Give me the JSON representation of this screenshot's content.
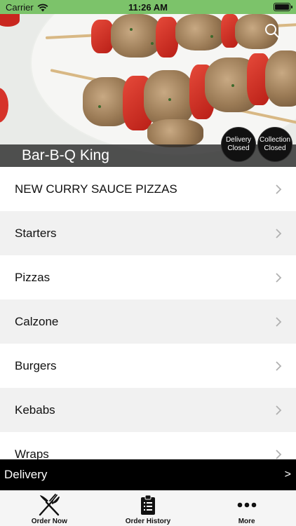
{
  "status_bar": {
    "carrier": "Carrier",
    "time": "11:26 AM"
  },
  "hero": {
    "restaurant_name": "Bar-B-Q King",
    "delivery_badge": [
      "Delivery",
      "Closed"
    ],
    "collection_badge": [
      "Collection",
      "Closed"
    ]
  },
  "menu": {
    "items": [
      {
        "label": "NEW CURRY SAUCE PIZZAS"
      },
      {
        "label": "Starters"
      },
      {
        "label": "Pizzas"
      },
      {
        "label": "Calzone"
      },
      {
        "label": "Burgers"
      },
      {
        "label": "Kebabs"
      },
      {
        "label": "Wraps"
      }
    ]
  },
  "delivery_bar": {
    "label": "Delivery",
    "arrow": ">"
  },
  "tabbar": {
    "tabs": [
      {
        "label": "Order Now",
        "icon": "fork-knife-icon"
      },
      {
        "label": "Order History",
        "icon": "clipboard-list-icon"
      },
      {
        "label": "More",
        "icon": "more-dots-icon"
      }
    ]
  },
  "colors": {
    "status_bar": "#7cc36a",
    "delivery_bar": "#000000",
    "row_alt": "#f1f1f1"
  }
}
